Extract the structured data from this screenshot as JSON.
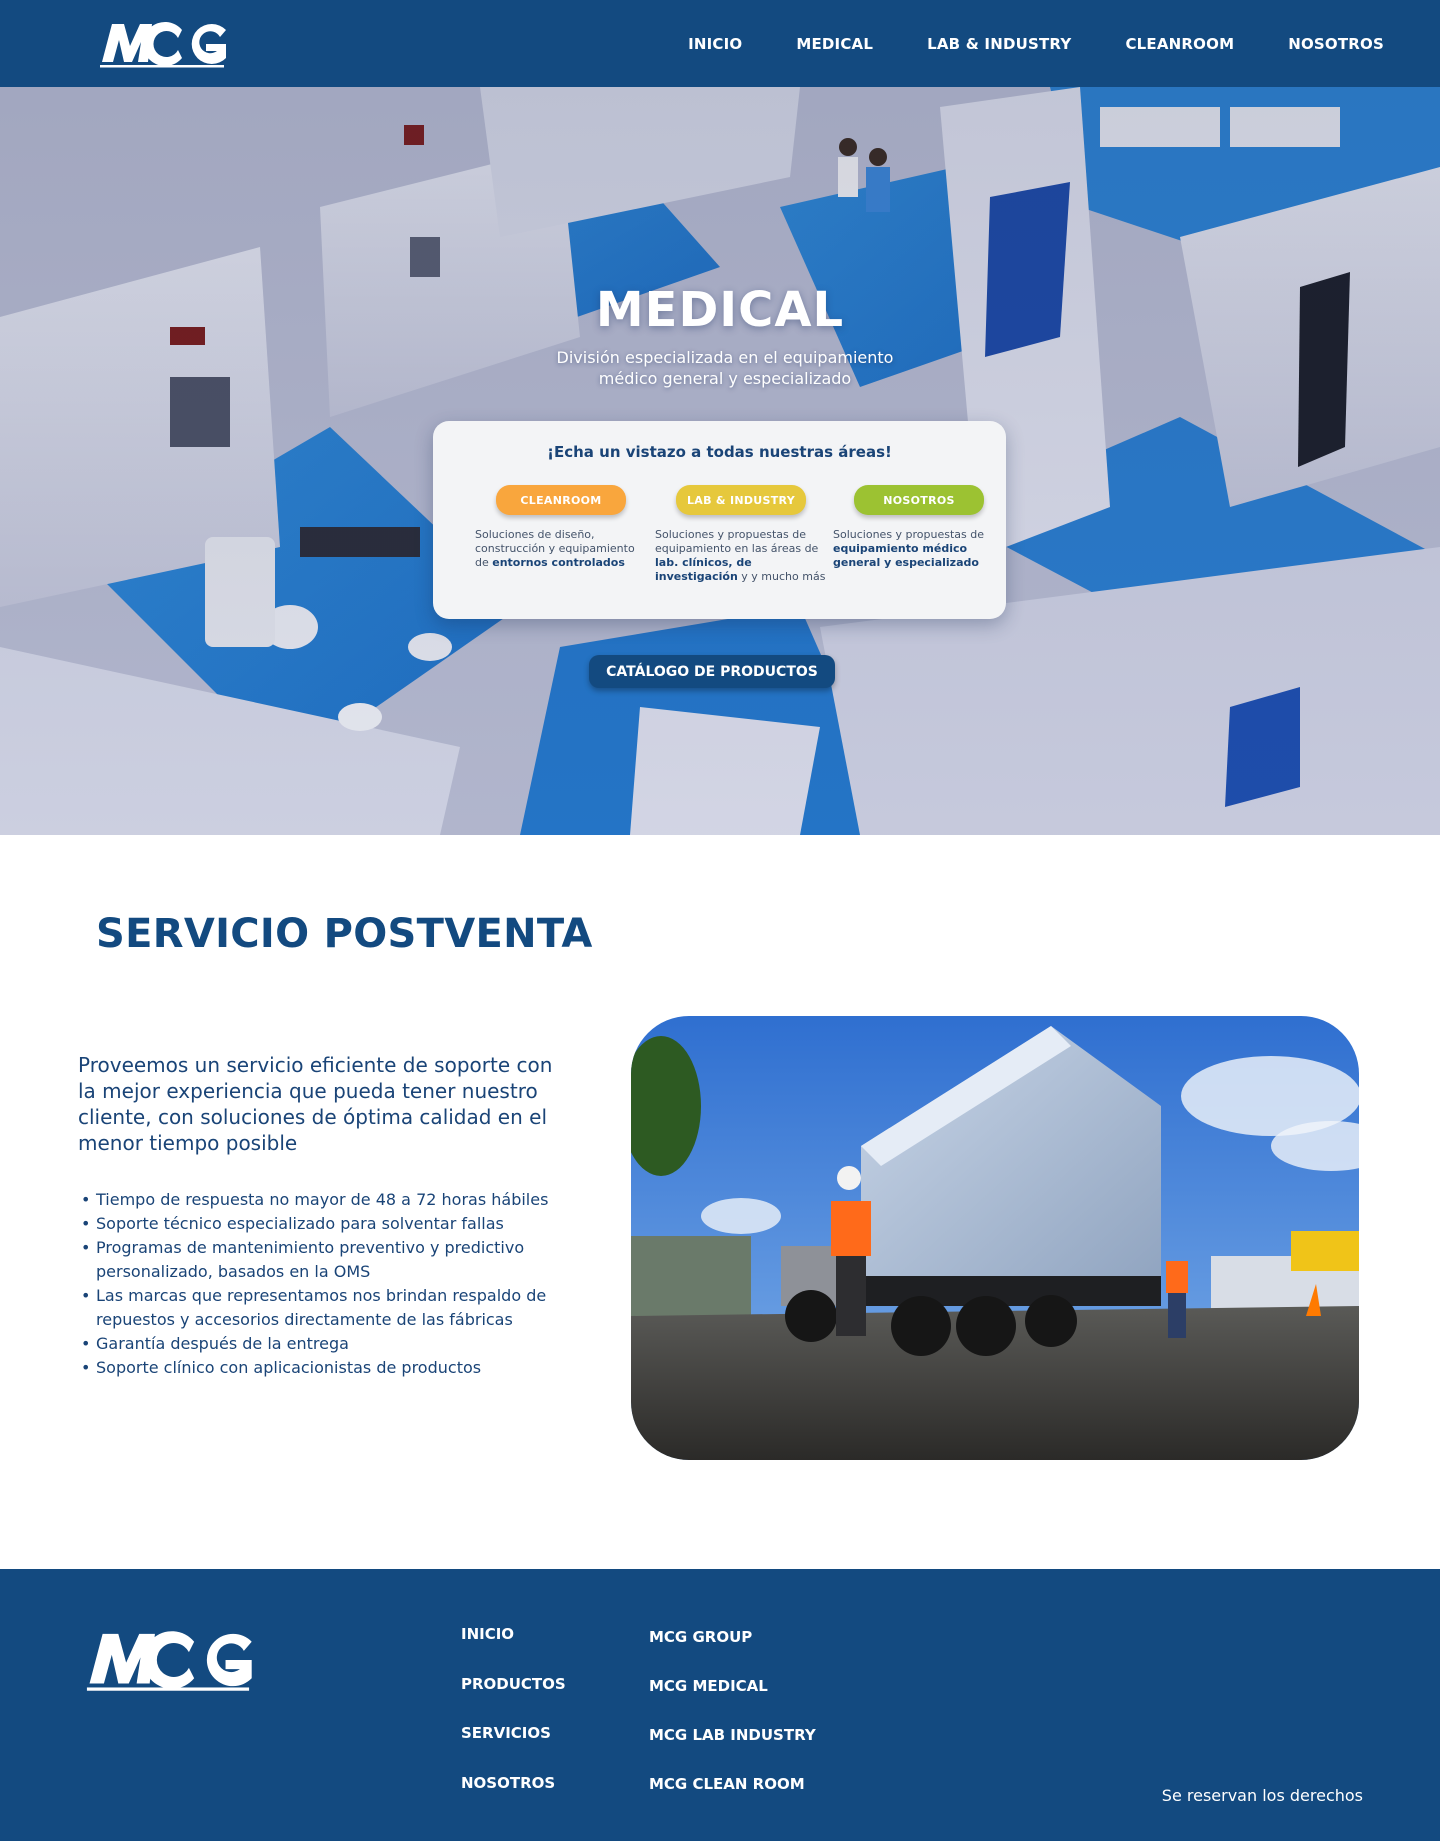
{
  "brand": {
    "logo_text": "MCG"
  },
  "header": {
    "nav": [
      "INICIO",
      "MEDICAL",
      "LAB & INDUSTRY",
      "CLEANROOM",
      "NOSOTROS"
    ]
  },
  "hero": {
    "title": "MEDICAL",
    "subtitle": "División especializada en el equipamiento médico general y especializado",
    "areas_card": {
      "title": "¡Echa un vistazo a todas nuestras áreas!",
      "areas": [
        {
          "label": "CLEANROOM",
          "color": "#f9a63d",
          "desc_plain": "Soluciones de diseño, construcción y equipamiento de ",
          "desc_bold": "entornos controlados",
          "desc_tail": ""
        },
        {
          "label": "LAB & INDUSTRY",
          "color": "#e6c83c",
          "desc_plain": "Soluciones y propuestas de equipamiento en las áreas de ",
          "desc_bold": "lab. clínicos, de investigación",
          "desc_tail": " y y mucho más"
        },
        {
          "label": "NOSOTROS",
          "color": "#9cc232",
          "desc_plain": "Soluciones y propuestas de ",
          "desc_bold": "equipamiento médico general y especializado",
          "desc_tail": ""
        }
      ]
    },
    "catalog_button": "CATÁLOGO DE PRODUCTOS"
  },
  "service": {
    "title": "SERVICIO POSTVENTA",
    "lead": "Proveemos un servicio eficiente de soporte con la mejor experiencia que pueda tener nuestro cliente, con soluciones de óptima calidad en el menor tiempo posible",
    "items": [
      "Tiempo de respuesta no mayor de 48 a 72 horas hábiles",
      "Soporte técnico especializado para solventar fallas",
      "Programas de mantenimiento preventivo y predictivo personalizado, basados en la OMS",
      "Las marcas que representamos nos brindan respaldo de repuestos y accesorios directamente de las fábricas",
      "Garantía después de la entrega",
      "Soporte clínico con aplicacionistas de productos"
    ]
  },
  "footer": {
    "col1": [
      "INICIO",
      "PRODUCTOS",
      "SERVICIOS",
      "NOSOTROS"
    ],
    "col2": [
      "MCG GROUP",
      "MCG MEDICAL",
      "MCG LAB INDUSTRY",
      "MCG CLEAN ROOM"
    ],
    "copyright": "Se reservan los derechos"
  },
  "colors": {
    "primary": "#134a80",
    "text": "#1a4477",
    "card_bg": "#f3f4f6"
  }
}
